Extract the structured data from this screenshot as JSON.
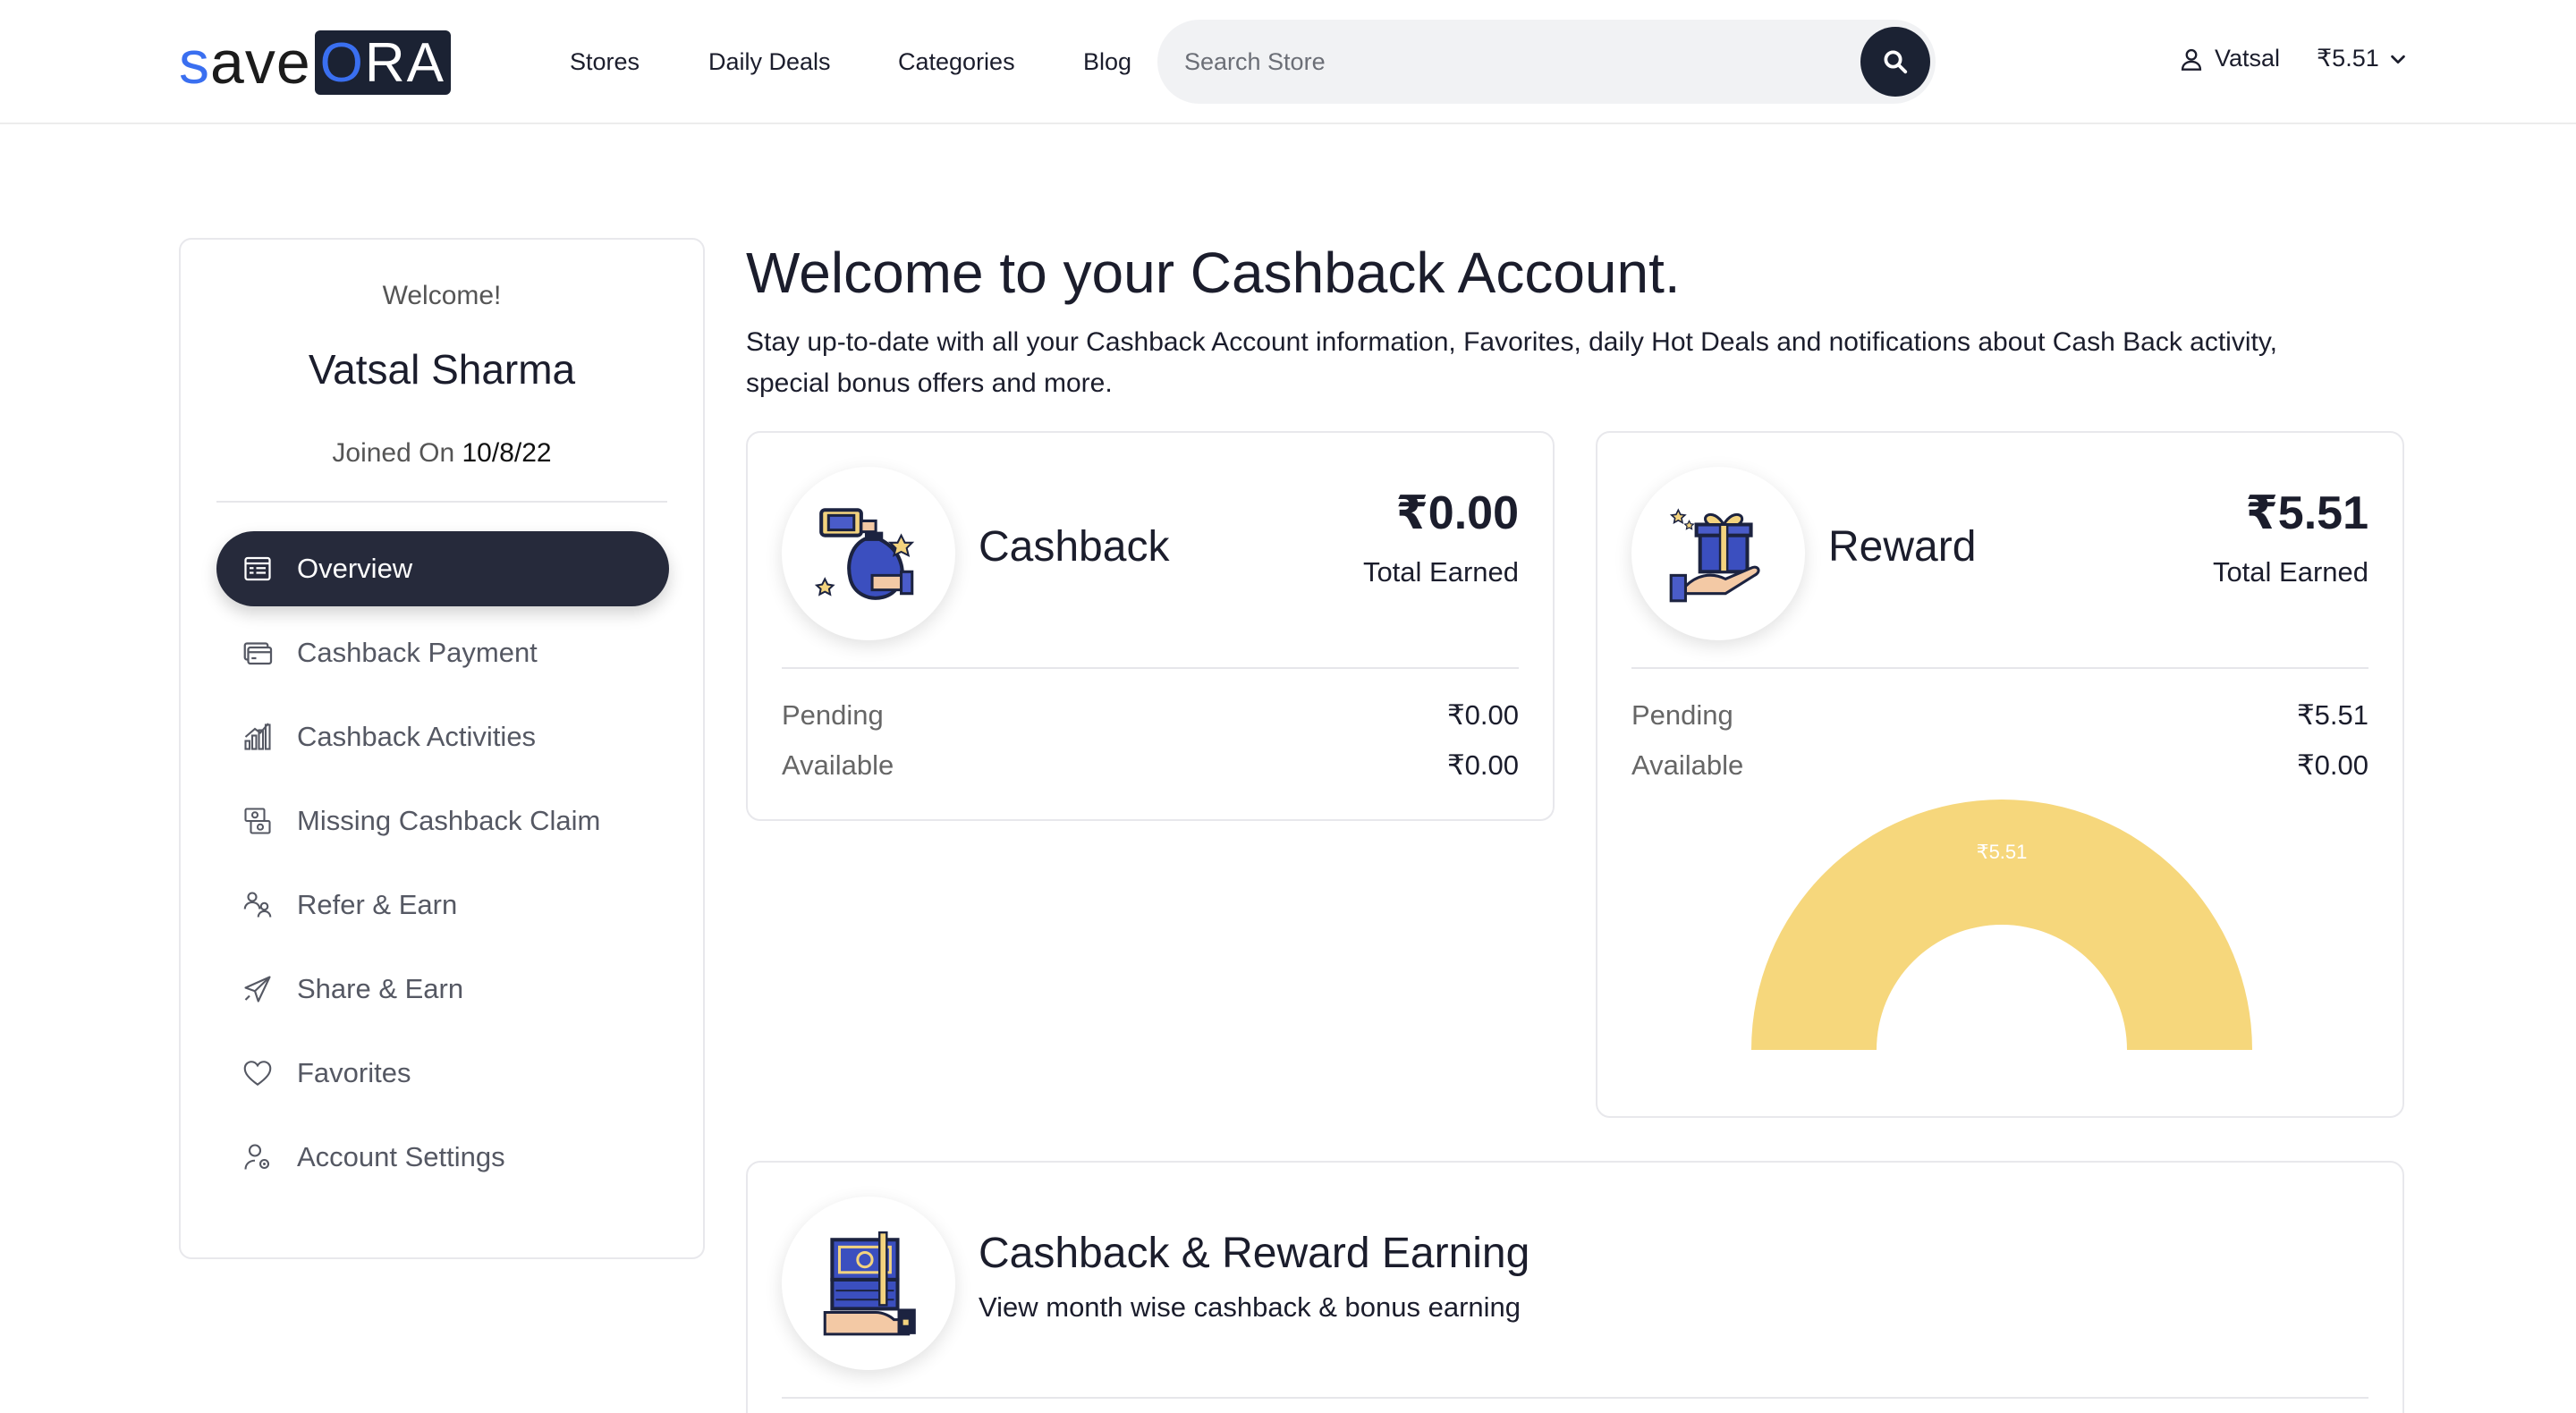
{
  "brand": {
    "logo_prefix": "save",
    "logo_suffix": "ORA"
  },
  "nav": [
    "Stores",
    "Daily Deals",
    "Categories",
    "Blog"
  ],
  "search": {
    "placeholder": "Search Store"
  },
  "user": {
    "name": "Vatsal",
    "balance": "₹5.51"
  },
  "sidebar": {
    "welcome": "Welcome!",
    "full_name": "Vatsal Sharma",
    "joined_label": "Joined On",
    "joined_date": "10/8/22",
    "items": [
      {
        "label": "Overview",
        "icon": "overview-icon",
        "active": true
      },
      {
        "label": "Cashback Payment",
        "icon": "payment-card-icon"
      },
      {
        "label": "Cashback Activities",
        "icon": "activity-chart-icon"
      },
      {
        "label": "Missing Cashback Claim",
        "icon": "claim-money-icon"
      },
      {
        "label": "Refer & Earn",
        "icon": "refer-people-icon"
      },
      {
        "label": "Share & Earn",
        "icon": "paper-plane-icon"
      },
      {
        "label": "Favorites",
        "icon": "heart-icon"
      },
      {
        "label": "Account Settings",
        "icon": "account-settings-icon"
      }
    ]
  },
  "main": {
    "title": "Welcome to your Cashback Account.",
    "lead": "Stay up-to-date with all your Cashback Account information, Favorites, daily Hot Deals and notifications about Cash Back activity, special bonus offers and more."
  },
  "cashback_card": {
    "title": "Cashback",
    "amount": "₹0.00",
    "amount_label": "Total Earned",
    "pending_label": "Pending",
    "pending_value": "₹0.00",
    "available_label": "Available",
    "available_value": "₹0.00"
  },
  "reward_card": {
    "title": "Reward",
    "amount": "₹5.51",
    "amount_label": "Total Earned",
    "pending_label": "Pending",
    "pending_value": "₹5.51",
    "available_label": "Available",
    "available_value": "₹0.00"
  },
  "chart_data": {
    "type": "pie",
    "style": "half-doughnut",
    "categories": [
      "Pending",
      "Available"
    ],
    "values": [
      5.51,
      0.0
    ],
    "data_labels": [
      "₹5.51"
    ],
    "colors": [
      "#f6d77c",
      "#e0e0e0"
    ]
  },
  "earning_card": {
    "title": "Cashback & Reward Earning",
    "subtitle": "View month wise cashback & bonus earning"
  },
  "colors": {
    "accent": "#262a3b",
    "brand_blue": "#3a6ff0",
    "chart_fill": "#f6d77c"
  }
}
